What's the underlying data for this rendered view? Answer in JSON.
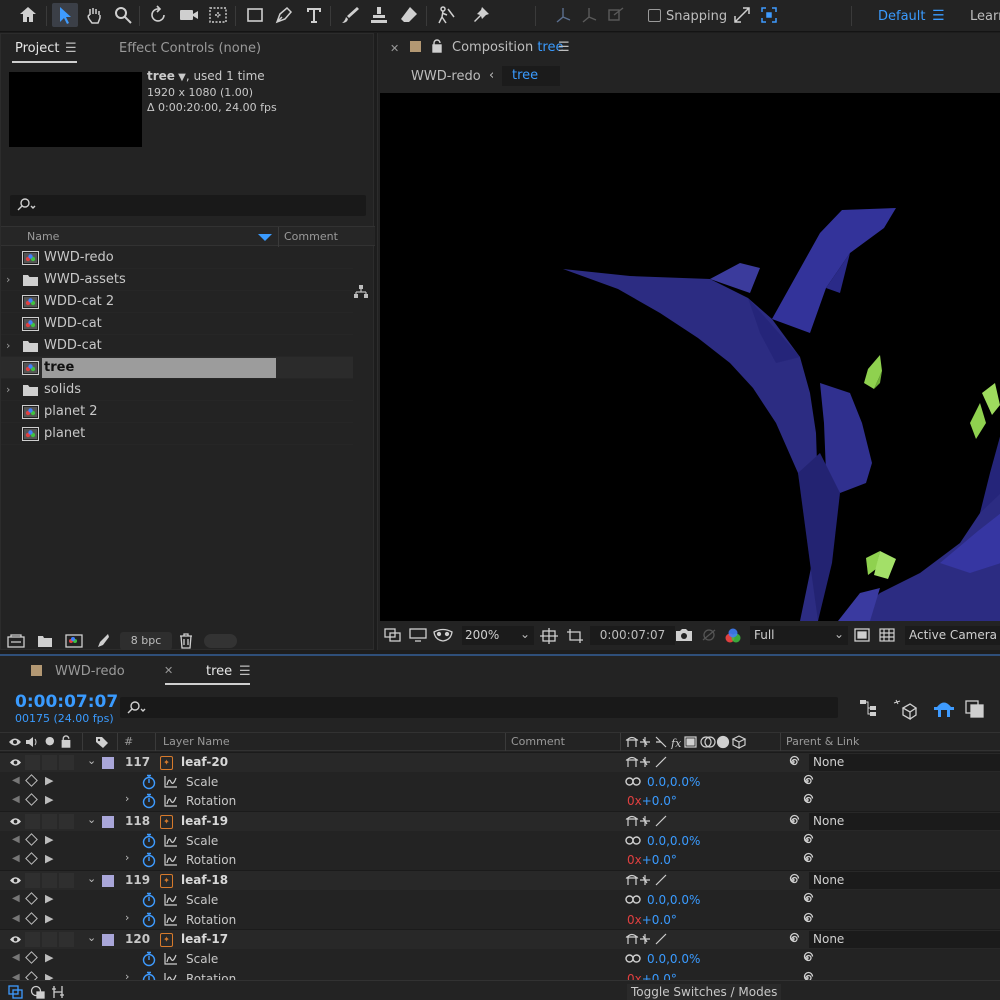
{
  "workspace": {
    "snapping_label": "Snapping",
    "default_label": "Default",
    "learn_label": "Learn"
  },
  "project": {
    "tab_project": "Project",
    "tab_effect_controls": "Effect Controls (none)",
    "selected_item": {
      "name": "tree",
      "usage": ", used 1 time",
      "dimensions": "1920 x 1080 (1.00)",
      "duration": "Δ 0:00:20:00, 24.00 fps"
    },
    "columns": {
      "name": "Name",
      "comment": "Comment"
    },
    "items": [
      {
        "label": "WWD-redo",
        "type": "composition",
        "expandable": false,
        "selected": false
      },
      {
        "label": "WWD-assets",
        "type": "folder",
        "expandable": true,
        "selected": false
      },
      {
        "label": "WDD-cat 2",
        "type": "composition",
        "expandable": false,
        "selected": false
      },
      {
        "label": "WDD-cat",
        "type": "composition",
        "expandable": false,
        "selected": false
      },
      {
        "label": "WDD-cat",
        "type": "folder",
        "expandable": true,
        "selected": false
      },
      {
        "label": "tree",
        "type": "composition",
        "expandable": false,
        "selected": true
      },
      {
        "label": "solids",
        "type": "folder",
        "expandable": true,
        "selected": false
      },
      {
        "label": "planet 2",
        "type": "composition",
        "expandable": false,
        "selected": false
      },
      {
        "label": "planet",
        "type": "composition",
        "expandable": false,
        "selected": false
      }
    ],
    "bpc_label": "8 bpc"
  },
  "composition": {
    "tab_prefix": "Composition",
    "tab_name": "tree",
    "breadcrumbs": [
      "WWD-redo",
      "tree"
    ],
    "zoom": "200%",
    "current_time": "0:00:07:07",
    "resolution": "Full",
    "camera": "Active Camera",
    "colors": {
      "branch": "#2c2c82",
      "leaf": "#8fd14f",
      "background": "#000000"
    }
  },
  "timeline": {
    "tabs": [
      "WWD-redo",
      "tree"
    ],
    "timecode": "0:00:07:07",
    "frames": "00175 (24.00 fps)",
    "headers": {
      "num": "#",
      "layer_name": "Layer Name",
      "comment": "Comment",
      "parent": "Parent & Link"
    },
    "layers": [
      {
        "num": "117",
        "name": "leaf-20",
        "parent": "None",
        "scale_value": "0.0,0.0%",
        "rotation_turns": "0x",
        "rotation_degrees": "+0.0°"
      },
      {
        "num": "118",
        "name": "leaf-19",
        "parent": "None",
        "scale_value": "0.0,0.0%",
        "rotation_turns": "0x",
        "rotation_degrees": "+0.0°"
      },
      {
        "num": "119",
        "name": "leaf-18",
        "parent": "None",
        "scale_value": "0.0,0.0%",
        "rotation_turns": "0x",
        "rotation_degrees": "+0.0°"
      },
      {
        "num": "120",
        "name": "leaf-17",
        "parent": "None",
        "scale_value": "0.0,0.0%",
        "rotation_turns": "0x",
        "rotation_degrees": "+0.0°"
      }
    ],
    "prop_labels": {
      "scale": "Scale",
      "rotation": "Rotation"
    },
    "toggle_label": "Toggle Switches / Modes"
  }
}
